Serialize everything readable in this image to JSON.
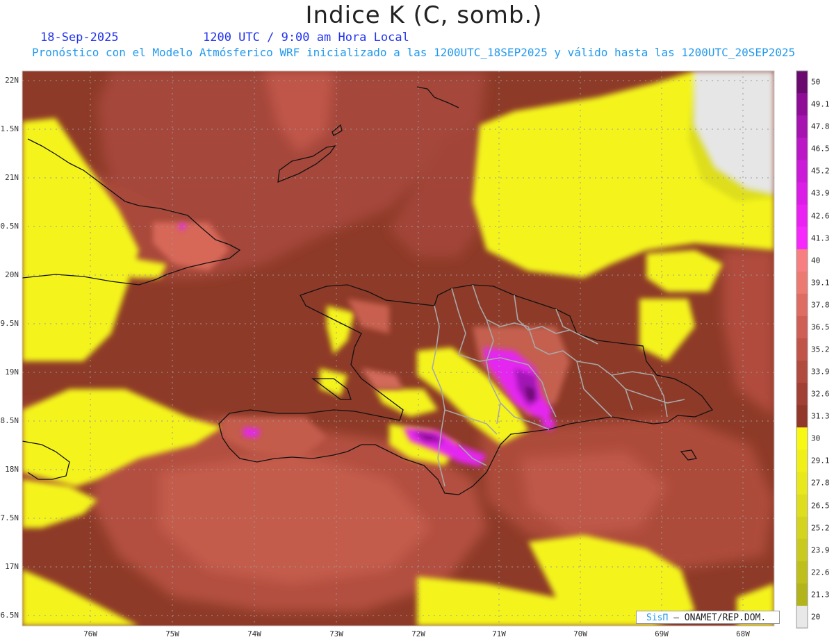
{
  "header": {
    "title": "Indice K (C, somb.)",
    "date": "18-Sep-2025",
    "time": "1200 UTC / 9:00 am Hora Local",
    "description": "Pronóstico con el Modelo Atmósferico WRF inicializado a las 1200UTC_18SEP2025 y válido hasta las  1200UTC_20SEP2025"
  },
  "axes": {
    "lat_labels": [
      "22N",
      "1.5N",
      "21N",
      "0.5N",
      "20N",
      "9.5N",
      "19N",
      "8.5N",
      "18N",
      "7.5N",
      "17N",
      "6.5N"
    ],
    "lon_labels": [
      "76W",
      "75W",
      "74W",
      "73W",
      "72W",
      "71W",
      "70W",
      "69W",
      "68W"
    ]
  },
  "colorbar": {
    "labels": [
      "50",
      "49.1",
      "47.8",
      "46.5",
      "45.2",
      "43.9",
      "42.6",
      "41.3",
      "40",
      "39.1",
      "37.8",
      "36.5",
      "35.2",
      "33.9",
      "32.6",
      "31.3",
      "30",
      "29.1",
      "27.8",
      "26.5",
      "25.2",
      "23.9",
      "22.6",
      "21.3",
      "20"
    ],
    "colors": [
      "#6a0a6e",
      "#8e0c96",
      "#a613b0",
      "#bb17c7",
      "#cc1ad9",
      "#dc1de8",
      "#eb21f3",
      "#f628fb",
      "#f77f82",
      "#ec7a72",
      "#de6c62",
      "#cf5f54",
      "#c15449",
      "#b14a3f",
      "#a24036",
      "#93372b",
      "#f8f815",
      "#f0f018",
      "#e8e81c",
      "#dede1f",
      "#d4d41f",
      "#caca1e",
      "#bfbf1c",
      "#b3b31a",
      "#e8e8e8"
    ]
  },
  "credit": {
    "sis": "SisΠ",
    "text": " – ONAMET/REP.DOM."
  }
}
